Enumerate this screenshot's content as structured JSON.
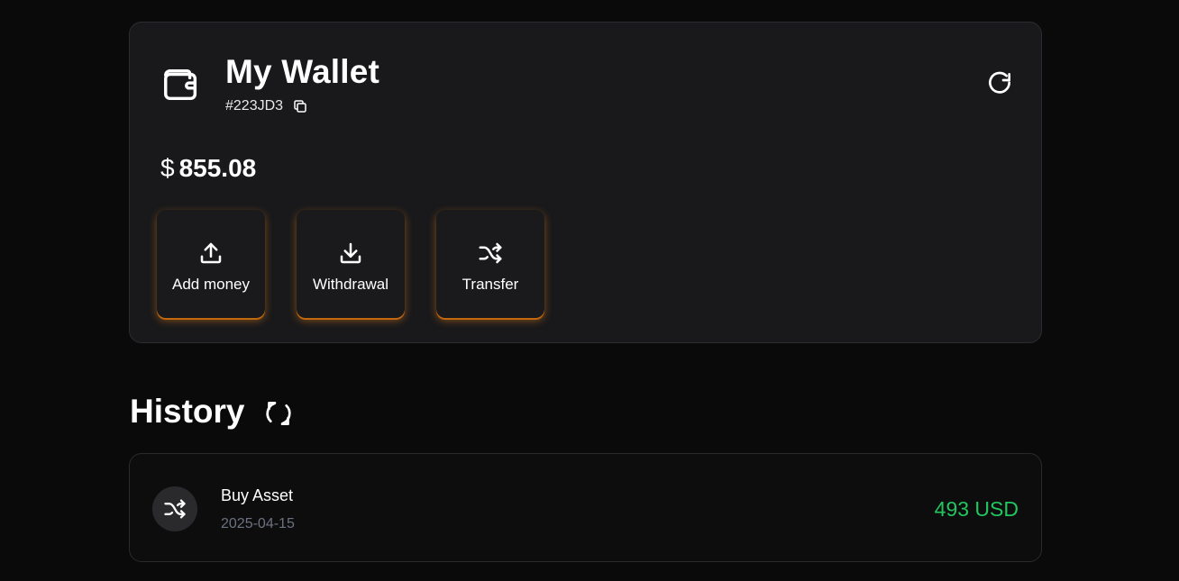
{
  "wallet": {
    "title": "My Wallet",
    "id": "#223JD3",
    "currency_symbol": "$",
    "balance": "855.08",
    "icons": {
      "wallet": "wallet-icon",
      "copy": "copy-icon",
      "refresh": "refresh-icon"
    },
    "actions": [
      {
        "label": "Add money",
        "icon": "upload-icon"
      },
      {
        "label": "Withdrawal",
        "icon": "download-icon"
      },
      {
        "label": "Transfer",
        "icon": "shuffle-icon"
      }
    ]
  },
  "history": {
    "title": "History",
    "refresh_icon": "sync-icon",
    "items": [
      {
        "name": "Buy Asset",
        "date": "2025-04-15",
        "amount": "493 USD",
        "icon": "shuffle-icon"
      }
    ]
  },
  "colors": {
    "background": "#0a0a0b",
    "card": "#19191b",
    "accent_glow": "#d67618",
    "amount_positive": "#22c55e",
    "muted_text": "#6b7280"
  }
}
